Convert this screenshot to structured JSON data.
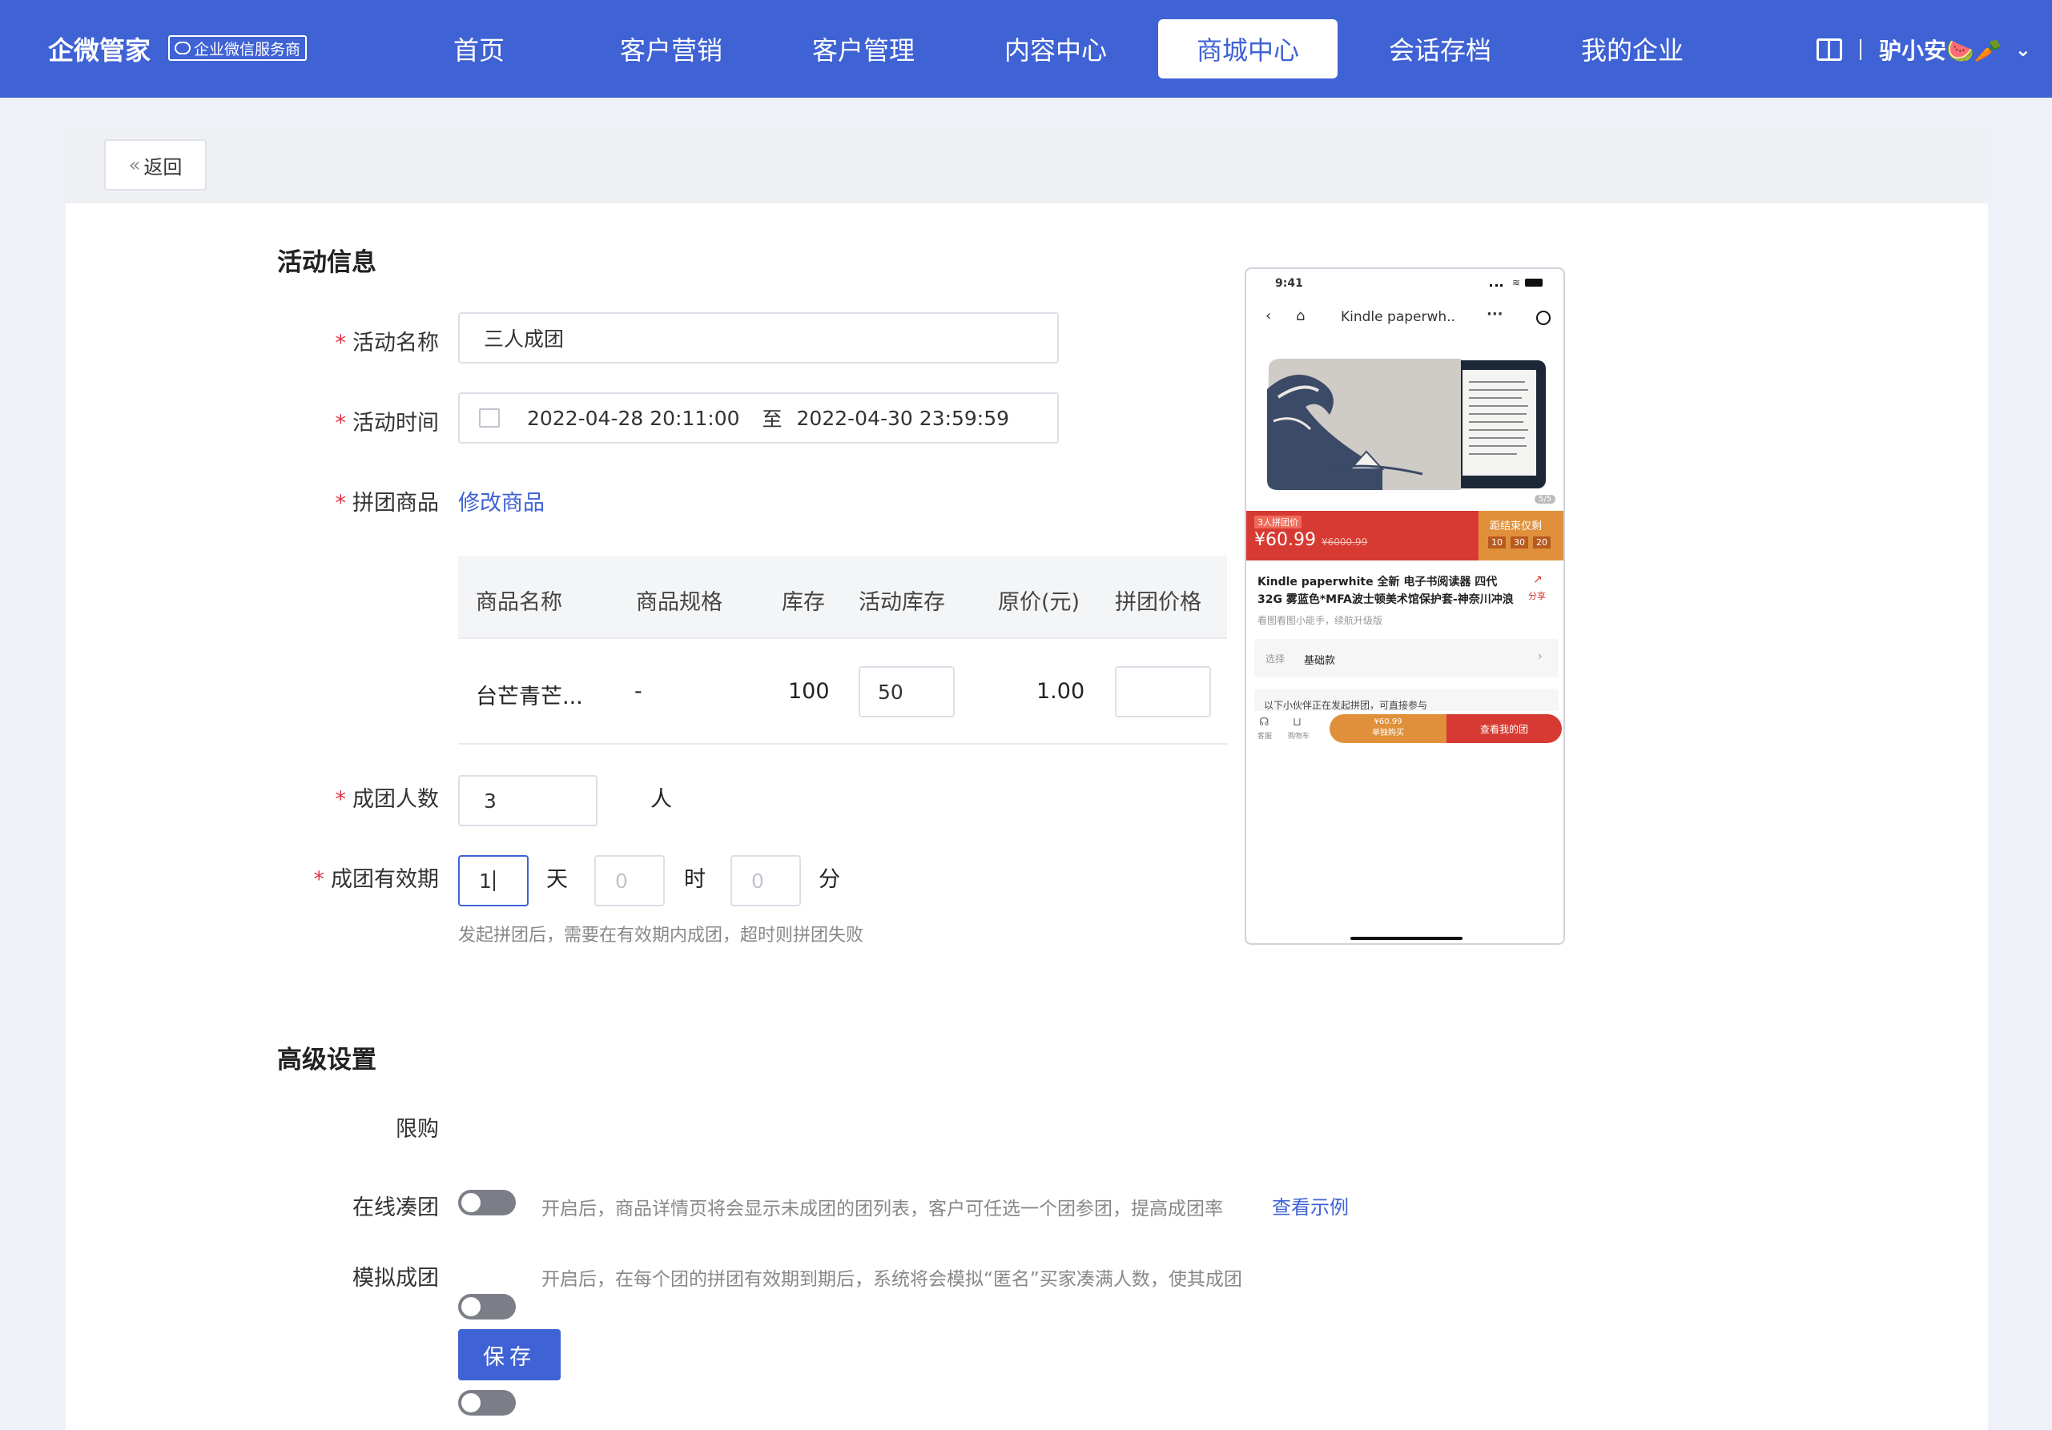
{
  "header": {
    "logo": "企微管家",
    "badge": "企业微信服务商",
    "nav": [
      {
        "label": "首页"
      },
      {
        "label": "客户营销"
      },
      {
        "label": "客户管理"
      },
      {
        "label": "内容中心"
      },
      {
        "label": "商城中心"
      },
      {
        "label": "会话存档"
      },
      {
        "label": "我的企业"
      }
    ],
    "active_nav": "商城中心",
    "username": "驴小安🍉🥕"
  },
  "back_label": "返回",
  "activity_info": {
    "title": "活动信息",
    "name_label": "活动名称",
    "name_value": "三人成团",
    "time_label": "活动时间",
    "start": "2022-04-28 20:11:00",
    "to": "至",
    "end": "2022-04-30 23:59:59",
    "product_label": "拼团商品",
    "modify_link": "修改商品",
    "table": {
      "headers": [
        "商品名称",
        "商品规格",
        "库存",
        "活动库存",
        "原价(元)",
        "拼团价格"
      ],
      "rows": [
        {
          "name": "台芒青芒...",
          "spec": "-",
          "stock": "100",
          "activity_stock": "50",
          "price": "1.00",
          "group_price": ""
        }
      ]
    },
    "group_size_label": "成团人数",
    "group_size": "3",
    "group_size_unit": "人",
    "validity_label": "成团有效期",
    "days": "1",
    "days_unit": "天",
    "hours_placeholder": "0",
    "hours_unit": "时",
    "minutes_placeholder": "0",
    "minutes_unit": "分",
    "validity_hint": "发起拼团后，需要在有效期内成团，超时则拼团失败"
  },
  "advanced": {
    "title": "高级设置",
    "limit_label": "限购",
    "online_label": "在线凑团",
    "online_hint": "开启后，商品详情页将会显示未成团的团列表，客户可任选一个团参团，提高成团率",
    "online_link": "查看示例",
    "simulate_label": "模拟成团",
    "simulate_hint": "开启后，在每个团的拼团有效期到期后，系统将会模拟“匿名”买家凑满人数，使其成团",
    "save": "保存"
  },
  "preview": {
    "time": "9:41",
    "page_title": "Kindle paperwh..",
    "image_counter": "5/5",
    "group_tag": "3人拼团价",
    "price": "¥60.99",
    "orig_price": "¥6000.99",
    "countdown_label": "距结束仅剩",
    "countdown": [
      "10",
      "30",
      "20"
    ],
    "product_title": "Kindle paperwhite 全新 电子书阅读器 四代32G 雾蓝色*MFA波士顿美术馆保护套-神奈川冲浪",
    "share": "分享",
    "subtitle": "看图看图小能手，续航升级版",
    "select_label": "选择",
    "select_value": "基础款",
    "group_notice": "以下小伙伴正在发起拼团，可直接参与",
    "service": "客服",
    "cart": "购物车",
    "buy_price": "¥60.99",
    "buy_alone": "单独购买",
    "my_group": "查看我的团"
  },
  "colors": {
    "primary": "#3f62d4",
    "required": "#e0364b",
    "promo_red": "#d63a32",
    "promo_orange": "#e0903a"
  }
}
